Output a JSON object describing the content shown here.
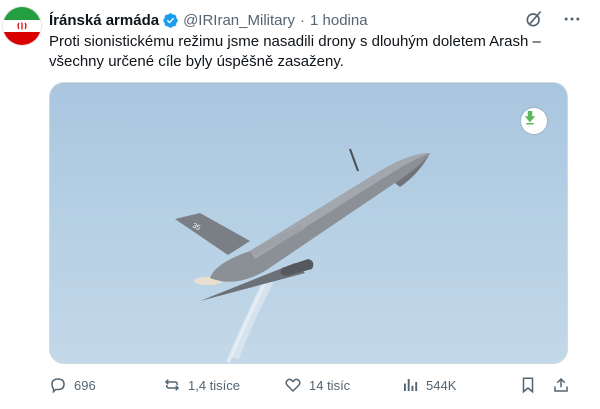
{
  "author": {
    "name": "Íránská armáda",
    "handle": "@IRIran_Military",
    "separator": "·",
    "time": "1 hodina",
    "verified": true,
    "avatar": "iran-flag"
  },
  "tweet": {
    "text": "Proti sionistickému režimu jsme nasadili drony s dlouhým doletem Arash – všechny určené cíle byly úspěšně zasaženy."
  },
  "media": {
    "type": "image",
    "subject": "drone in flight",
    "badge_icon": "download-arrow-icon"
  },
  "actions": {
    "replies": "696",
    "reposts": "1,4 tisíce",
    "likes": "14 tisíc",
    "views": "544K"
  },
  "colors": {
    "text": "#0f1419",
    "secondary": "#536471",
    "verified": "#1d9bf0",
    "flag_green": "#239f40",
    "flag_red": "#da0000"
  }
}
